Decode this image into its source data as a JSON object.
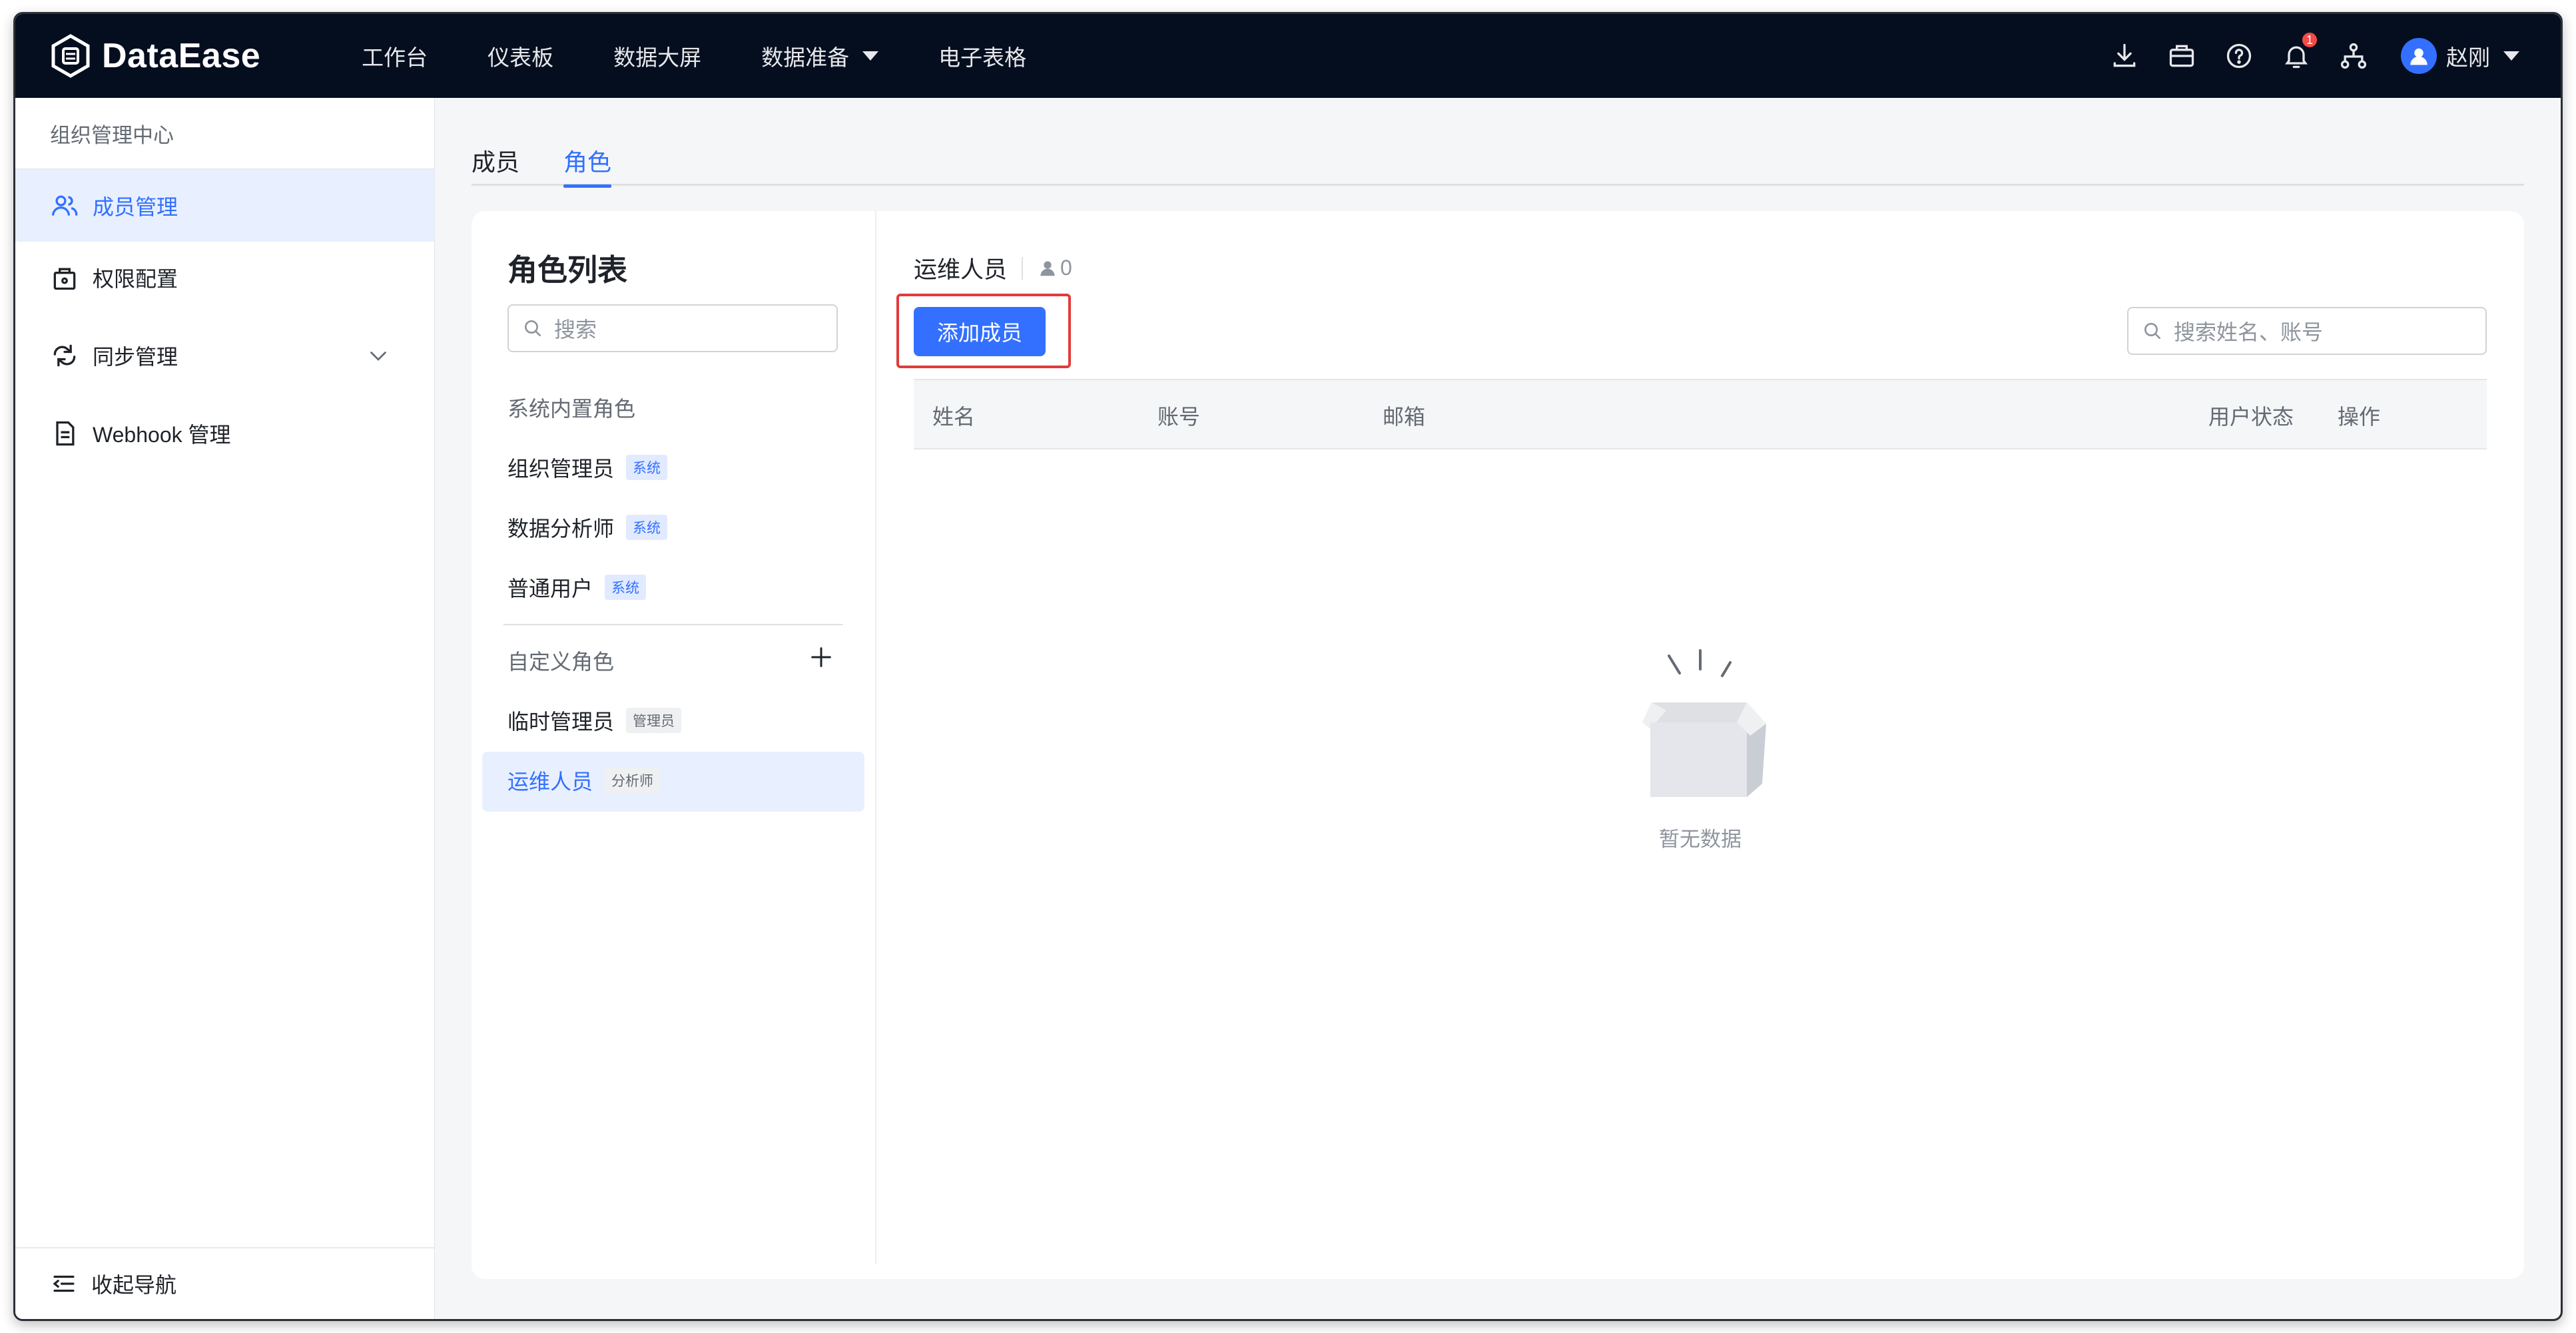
{
  "app": {
    "name": "DataEase"
  },
  "nav": {
    "items": [
      {
        "label": "工作台"
      },
      {
        "label": "仪表板"
      },
      {
        "label": "数据大屏"
      },
      {
        "label": "数据准备",
        "has_dropdown": true
      },
      {
        "label": "电子表格"
      }
    ],
    "notification_count": "1",
    "user_name": "赵刚"
  },
  "sidebar": {
    "title": "组织管理中心",
    "items": [
      {
        "label": "成员管理",
        "icon": "users-icon",
        "active": true
      },
      {
        "label": "权限配置",
        "icon": "lock-icon"
      },
      {
        "label": "同步管理",
        "icon": "sync-icon",
        "expandable": true
      },
      {
        "label": "Webhook 管理",
        "icon": "document-icon"
      }
    ],
    "collapse_label": "收起导航"
  },
  "tabs": [
    {
      "label": "成员"
    },
    {
      "label": "角色",
      "active": true
    }
  ],
  "role_panel": {
    "title": "角色列表",
    "search_placeholder": "搜索",
    "builtin_label": "系统内置角色",
    "builtin_roles": [
      {
        "name": "组织管理员",
        "tag": "系统"
      },
      {
        "name": "数据分析师",
        "tag": "系统"
      },
      {
        "name": "普通用户",
        "tag": "系统"
      }
    ],
    "custom_label": "自定义角色",
    "custom_roles": [
      {
        "name": "临时管理员",
        "tag": "管理员"
      },
      {
        "name": "运维人员",
        "tag": "分析师",
        "active": true
      }
    ]
  },
  "detail": {
    "role_name": "运维人员",
    "member_count": "0",
    "add_button": "添加成员",
    "search_placeholder": "搜索姓名、账号",
    "columns": [
      "姓名",
      "账号",
      "邮箱",
      "用户状态",
      "操作"
    ],
    "empty_text": "暂无数据"
  },
  "colors": {
    "primary": "#3370ff",
    "topbar": "#050e1f",
    "highlight_box": "#e13b3b"
  }
}
